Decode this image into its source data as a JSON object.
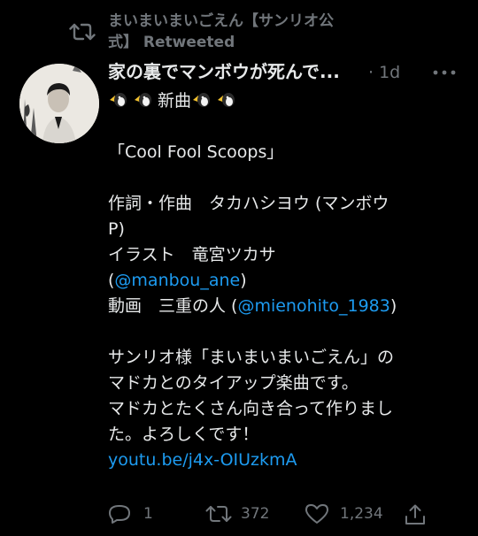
{
  "retweet": {
    "text_line1": "まいまいまいごえん【サンリオ公",
    "text_line2_prefix": "式】",
    "text_line2_suffix": " Retweeted"
  },
  "tweet": {
    "author_name": "家の裏でマンボウが死んで...",
    "separator": " · ",
    "time": "1d",
    "first_line_text": "新曲",
    "lines": {
      "title": "「Cool Fool Scoops」",
      "credit_lyrics_a": "作詞・作曲　タカハシヨウ (マンボウ",
      "credit_lyrics_b": "P)",
      "credit_illust": "イラスト　竜宮ツカサ",
      "illust_open": "(",
      "illust_handle": "@manbou_ane",
      "illust_close": ")",
      "video_prefix": "動画　三重の人 (",
      "video_handle": "@mienohito_1983",
      "video_close": ")",
      "desc1": "サンリオ様「まいまいまいごえん」の",
      "desc2": "マドカとのタイアップ楽曲です。",
      "desc3": "マドカとたくさん向き合って作りまし",
      "desc4": "た。よろしくです！",
      "url": "youtu.be/j4x-OIUzkmA"
    }
  },
  "actions": {
    "reply_count": "1",
    "retweet_count": "372",
    "like_count": "1,234"
  },
  "colors": {
    "background": "#000000",
    "text": "#e7e9ea",
    "muted": "#71767b",
    "link": "#1d9bf0"
  }
}
